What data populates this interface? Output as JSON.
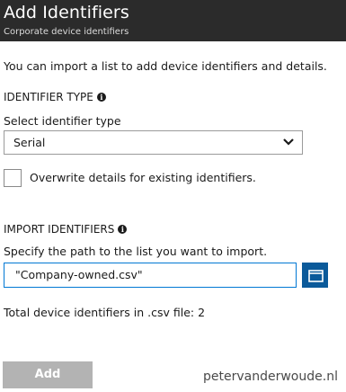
{
  "header": {
    "title": "Add Identifiers",
    "subtitle": "Corporate device identifiers"
  },
  "intro": "You can import a list to add device identifiers and details.",
  "identifier_type": {
    "section_label": "IDENTIFIER TYPE",
    "field_label": "Select identifier type",
    "selected_value": "Serial",
    "info_icon": "info-icon",
    "chevron_icon": "chevron-down-icon"
  },
  "overwrite": {
    "label": "Overwrite details for existing identifiers.",
    "checked": false
  },
  "import_identifiers": {
    "section_label": "IMPORT IDENTIFIERS",
    "field_label": "Specify the path to the list you want to import.",
    "path_value": "\"Company-owned.csv\"",
    "browse_icon": "folder-icon"
  },
  "total_text": "Total device identifiers in .csv file: 2",
  "add_button": "Add",
  "watermark": "petervanderwoude.nl",
  "colors": {
    "header_bg": "#2b2b2b",
    "accent": "#0078d4",
    "browse_bg": "#0b5a9a",
    "disabled_button": "#b3b3b3"
  }
}
